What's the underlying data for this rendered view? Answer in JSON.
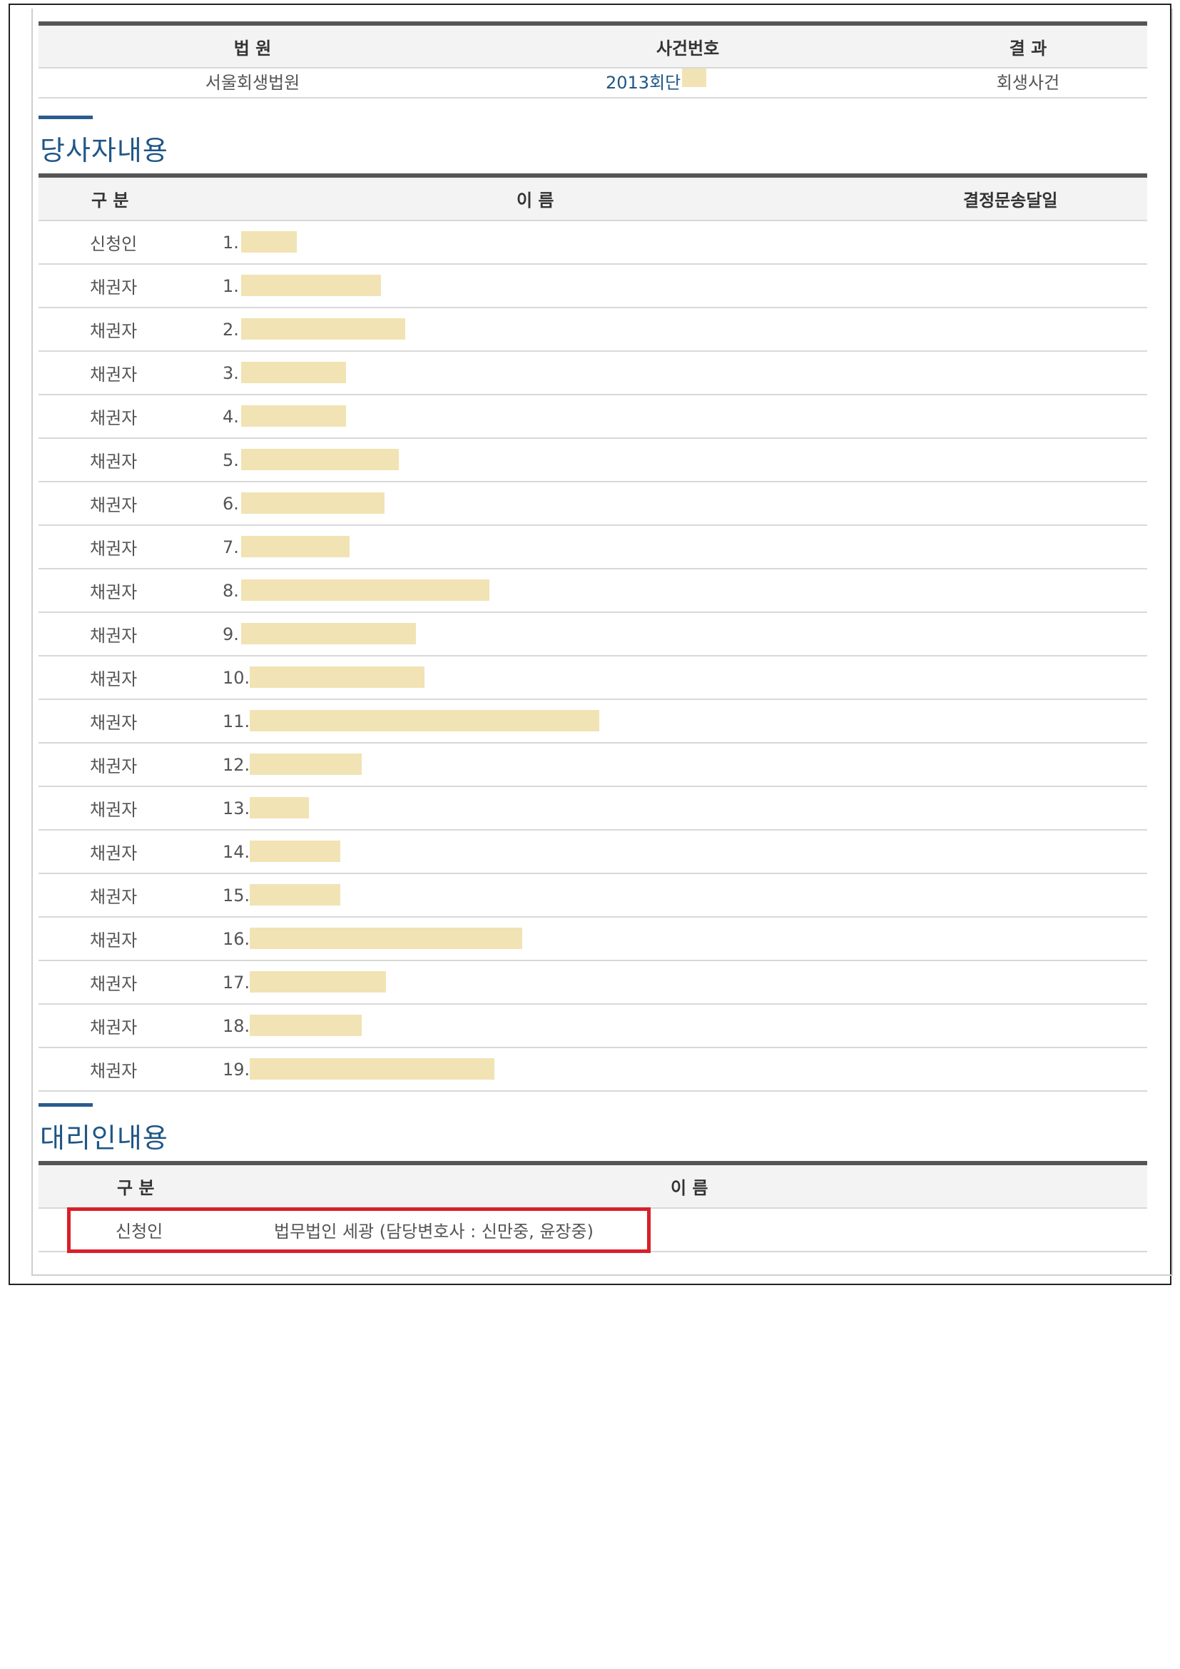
{
  "case_table": {
    "headers": [
      "법 원",
      "사건번호",
      "결 과"
    ],
    "row": {
      "court": "서울회생법원",
      "case_number": "2013회단",
      "result": "회생사건"
    }
  },
  "parties": {
    "title": "당사자내용",
    "headers": {
      "category": "구 분",
      "name": "이 름",
      "date": "결정문송달일"
    },
    "rows": [
      {
        "category": "신청인",
        "num": "1.",
        "redact_fraction": 0.16
      },
      {
        "category": "채권자",
        "num": "1.",
        "redact_fraction": 0.4
      },
      {
        "category": "채권자",
        "num": "2.",
        "redact_fraction": 0.47
      },
      {
        "category": "채권자",
        "num": "3.",
        "redact_fraction": 0.3
      },
      {
        "category": "채권자",
        "num": "4.",
        "redact_fraction": 0.3
      },
      {
        "category": "채권자",
        "num": "5.",
        "redact_fraction": 0.45
      },
      {
        "category": "채권자",
        "num": "6.",
        "redact_fraction": 0.41
      },
      {
        "category": "채권자",
        "num": "7.",
        "redact_fraction": 0.31
      },
      {
        "category": "채권자",
        "num": "8.",
        "redact_fraction": 0.71
      },
      {
        "category": "채권자",
        "num": "9.",
        "redact_fraction": 0.5
      },
      {
        "category": "채권자",
        "num": "10.",
        "redact_fraction": 0.5
      },
      {
        "category": "채권자",
        "num": "11.",
        "redact_fraction": 1.0
      },
      {
        "category": "채권자",
        "num": "12.",
        "redact_fraction": 0.32
      },
      {
        "category": "채권자",
        "num": "13.",
        "redact_fraction": 0.17
      },
      {
        "category": "채권자",
        "num": "14.",
        "redact_fraction": 0.26
      },
      {
        "category": "채권자",
        "num": "15.",
        "redact_fraction": 0.26
      },
      {
        "category": "채권자",
        "num": "16.",
        "redact_fraction": 0.78
      },
      {
        "category": "채권자",
        "num": "17.",
        "redact_fraction": 0.39
      },
      {
        "category": "채권자",
        "num": "18.",
        "redact_fraction": 0.32
      },
      {
        "category": "채권자",
        "num": "19.",
        "redact_fraction": 0.7
      }
    ]
  },
  "agents": {
    "title": "대리인내용",
    "headers": {
      "category": "구 분",
      "name": "이 름"
    },
    "row": {
      "category": "신청인",
      "name": "법무법인 세광 (담당변호사 : 신만중, 윤장중)"
    }
  },
  "colors": {
    "accent": "#1f5686",
    "redaction": "#f1e3b4",
    "highlight": "#d8202a"
  }
}
